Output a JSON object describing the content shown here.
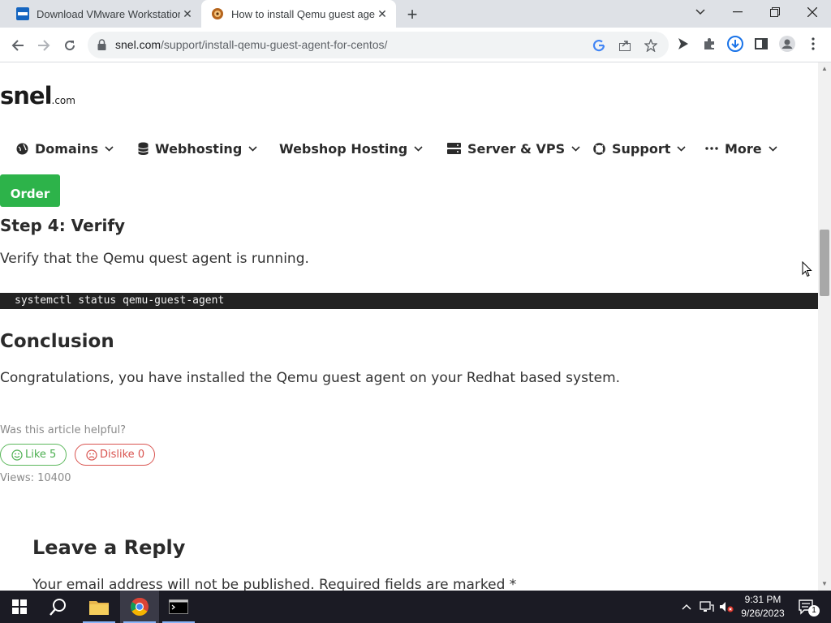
{
  "browser": {
    "tabs": [
      {
        "title": "Download VMware Workstation Pro",
        "favicon": "vmware-icon"
      },
      {
        "title": "How to install Qemu guest agent for CentOS",
        "favicon": "snel-icon"
      }
    ],
    "url_host": "snel.com",
    "url_path": "/support/install-qemu-guest-agent-for-centos/"
  },
  "site": {
    "logo": "snel",
    "logo_suffix": ".com",
    "nav": [
      {
        "label": "Domains",
        "icon": "globe-icon"
      },
      {
        "label": "Webhosting",
        "icon": "database-icon"
      },
      {
        "label": "Webshop Hosting",
        "icon": ""
      },
      {
        "label": "Server & VPS",
        "icon": "server-icon"
      },
      {
        "label": "Support",
        "icon": "lifebuoy-icon"
      },
      {
        "label": "More",
        "icon": "ellipsis-icon"
      }
    ],
    "order_label": "Order"
  },
  "article": {
    "step_heading": "Step 4: Verify",
    "verify_text": "Verify that the Qemu quest agent is running.",
    "code": "systemctl status qemu-guest-agent",
    "conclusion_heading": "Conclusion",
    "conclusion_text": "Congratulations,  you have installed the Qemu guest agent on your Redhat based system.",
    "helpful_label": "Was this article helpful?",
    "like_label": "Like 5",
    "dislike_label": "Dislike 0",
    "views": "Views: 10400"
  },
  "reply": {
    "heading": "Leave a Reply",
    "note": "Your email address will not be published. Required fields are marked *"
  },
  "taskbar": {
    "time": "9:31 PM",
    "date": "9/26/2023",
    "notification_count": "1"
  },
  "colors": {
    "order_green": "#2db34a",
    "like_green": "#4caf50",
    "dislike_red": "#d9534f",
    "code_bg": "#222222"
  }
}
